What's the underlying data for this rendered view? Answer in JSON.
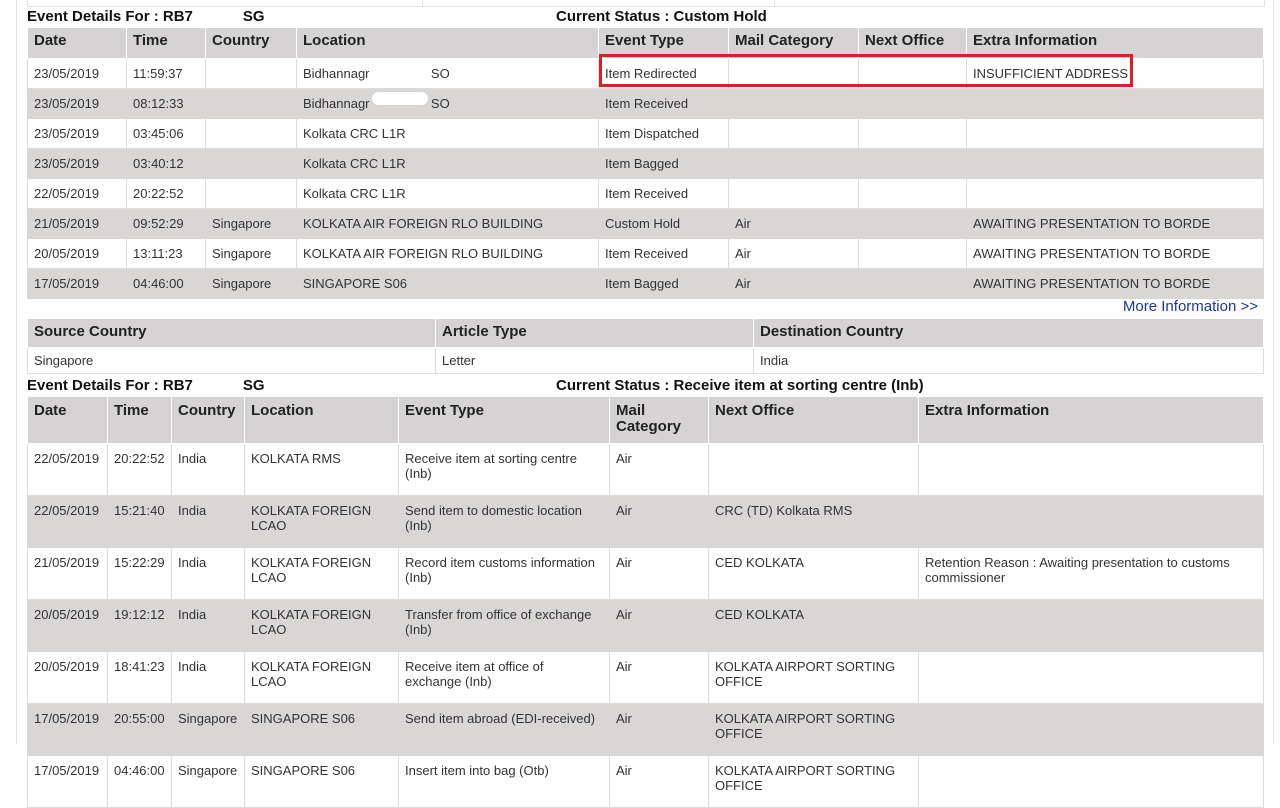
{
  "section1": {
    "label": "Event Details For : RB7            SG",
    "status": "Current Status : Custom Hold",
    "columns": [
      "Date",
      "Time",
      "Country",
      "Location",
      "Event Type",
      "Mail Category",
      "Next Office",
      "Extra Information"
    ],
    "rows": [
      [
        "23/05/2019",
        "11:59:37",
        "",
        "Bidhannagr                 SO",
        "Item Redirected",
        "",
        "",
        "INSUFFICIENT ADDRESS"
      ],
      [
        "23/05/2019",
        "08:12:33",
        "",
        "Bidhannagr                 SO",
        "Item Received",
        "",
        "",
        ""
      ],
      [
        "23/05/2019",
        "03:45:06",
        "",
        "Kolkata CRC L1R",
        "Item Dispatched",
        "",
        "",
        ""
      ],
      [
        "23/05/2019",
        "03:40:12",
        "",
        "Kolkata CRC L1R",
        "Item Bagged",
        "",
        "",
        ""
      ],
      [
        "22/05/2019",
        "20:22:52",
        "",
        "Kolkata CRC L1R",
        "Item Received",
        "",
        "",
        ""
      ],
      [
        "21/05/2019",
        "09:52:29",
        "Singapore",
        "KOLKATA AIR FOREIGN RLO BUILDING",
        "Custom Hold",
        "Air",
        "",
        "AWAITING PRESENTATION TO BORDE"
      ],
      [
        "20/05/2019",
        "13:11:23",
        "Singapore",
        "KOLKATA AIR FOREIGN RLO BUILDING",
        "Item Received",
        "Air",
        "",
        "AWAITING PRESENTATION TO BORDE"
      ],
      [
        "17/05/2019",
        "04:46:00",
        "Singapore",
        "SINGAPORE S06",
        "Item Bagged",
        "Air",
        "",
        "AWAITING PRESENTATION TO BORDE"
      ]
    ]
  },
  "more_info_link": "More Information >>",
  "summary": {
    "columns": [
      "Source Country",
      "Article Type",
      "Destination Country"
    ],
    "values": [
      "Singapore",
      "Letter",
      "India"
    ]
  },
  "section2": {
    "label": "Event Details For : RB7            SG",
    "status": "Current Status : Receive item at sorting centre (Inb)",
    "columns": [
      "Date",
      "Time",
      "Country",
      "Location",
      "Event Type",
      "Mail Category",
      "Next Office",
      "Extra Information"
    ],
    "rows": [
      [
        "22/05/2019",
        "20:22:52",
        "India",
        "KOLKATA RMS",
        "Receive item at sorting centre (Inb)",
        "Air",
        "",
        ""
      ],
      [
        "22/05/2019",
        "15:21:40",
        "India",
        "KOLKATA FOREIGN LCAO",
        "Send item to domestic location (Inb)",
        "Air",
        "CRC (TD) Kolkata RMS",
        ""
      ],
      [
        "21/05/2019",
        "15:22:29",
        "India",
        "KOLKATA FOREIGN LCAO",
        "Record item customs information (Inb)",
        "Air",
        "CED KOLKATA",
        "Retention Reason : Awaiting presentation to customs commissioner"
      ],
      [
        "20/05/2019",
        "19:12:12",
        "India",
        "KOLKATA FOREIGN LCAO",
        "Transfer from office of exchange (Inb)",
        "Air",
        "CED KOLKATA",
        ""
      ],
      [
        "20/05/2019",
        "18:41:23",
        "India",
        "KOLKATA FOREIGN LCAO",
        "Receive item at office of exchange (Inb)",
        "Air",
        "KOLKATA AIRPORT SORTING OFFICE",
        ""
      ],
      [
        "17/05/2019",
        "20:55:00",
        "Singapore",
        "SINGAPORE S06",
        "Send item abroad (EDI-received)",
        "Air",
        "KOLKATA AIRPORT SORTING OFFICE",
        ""
      ],
      [
        "17/05/2019",
        "04:46:00",
        "Singapore",
        "SINGAPORE S06",
        "Insert item into bag (Otb)",
        "Air",
        "KOLKATA AIRPORT SORTING OFFICE",
        ""
      ]
    ]
  },
  "colors": {
    "header_bg": "#d5d3d3",
    "alt_row_bg": "#d9d6d6",
    "link": "#1a36a6",
    "highlight": "#d8202a"
  }
}
